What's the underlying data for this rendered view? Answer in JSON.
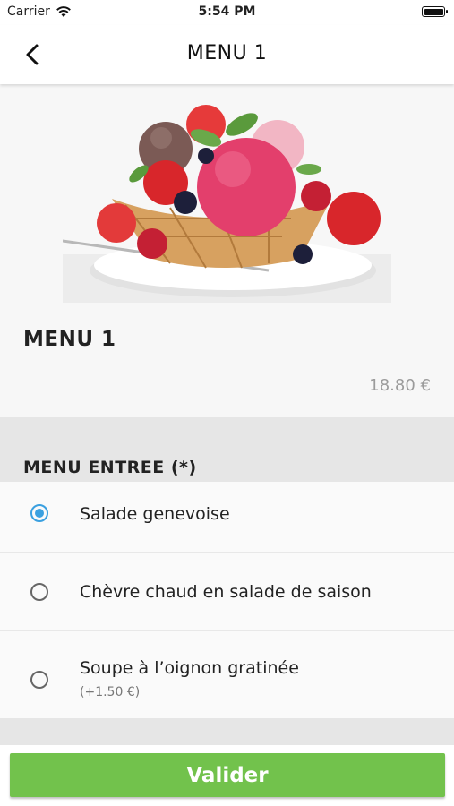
{
  "status_bar": {
    "carrier": "Carrier",
    "time": "5:54 PM"
  },
  "nav": {
    "title": "MENU 1"
  },
  "product": {
    "title": "MENU 1",
    "price": "18.80 €",
    "image": "ice-cream-dessert-image"
  },
  "section": {
    "title": "MENU ENTREE (*)"
  },
  "options": [
    {
      "label": "Salade genevoise",
      "sub": "",
      "selected": true
    },
    {
      "label": "Chèvre chaud en salade de saison",
      "sub": "",
      "selected": false
    },
    {
      "label": "Soupe à l’oignon gratinée",
      "sub": "(+1.50 €)",
      "selected": false
    }
  ],
  "footer": {
    "validate_label": "Valider"
  },
  "colors": {
    "accent": "#3aa0e0",
    "validate": "#72c24c"
  }
}
